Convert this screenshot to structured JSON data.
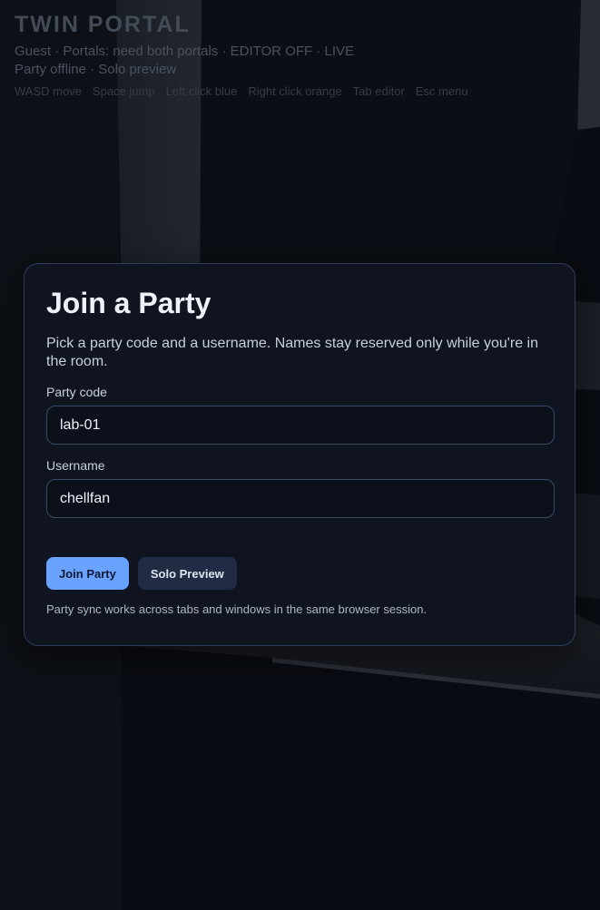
{
  "hud": {
    "title": "TWIN PORTAL",
    "status_line": "Guest · Portals: need both portals · EDITOR OFF · LIVE",
    "party_line": "Party offline · Solo preview",
    "controls": [
      "WASD move",
      "Space jump",
      "Left click blue",
      "Right click orange",
      "Tab editor",
      "Esc menu"
    ]
  },
  "modal": {
    "title": "Join a Party",
    "description": "Pick a party code and a username. Names stay reserved only while you're in the room.",
    "party_code_label": "Party code",
    "party_code_value": "lab-01",
    "username_label": "Username",
    "username_value": "chellfan",
    "join_button": "Join Party",
    "solo_button": "Solo Preview",
    "footnote": "Party sync works across tabs and windows in the same browser session."
  },
  "colors": {
    "background": "#090c12",
    "accent": "#6aa3ff",
    "panel": "#0f1420",
    "panel_border": "#2f3d5a"
  }
}
